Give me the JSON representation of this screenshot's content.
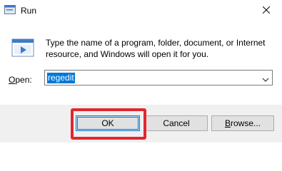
{
  "window": {
    "title": "Run",
    "close_icon": "close-icon",
    "app_icon": "run-app-icon"
  },
  "dialog": {
    "description": "Type the name of a program, folder, document, or Internet resource, and Windows will open it for you.",
    "open_label_accel": "O",
    "open_label_rest": "pen:",
    "input_value": "regedit",
    "dropdown_icon": "chevron-down-icon"
  },
  "buttons": {
    "ok": "OK",
    "cancel": "Cancel",
    "browse_accel": "B",
    "browse_rest": "rowse..."
  },
  "colors": {
    "selection": "#0078d7",
    "highlight_box": "#e3262f",
    "footer_bg": "#f0f0f0"
  }
}
